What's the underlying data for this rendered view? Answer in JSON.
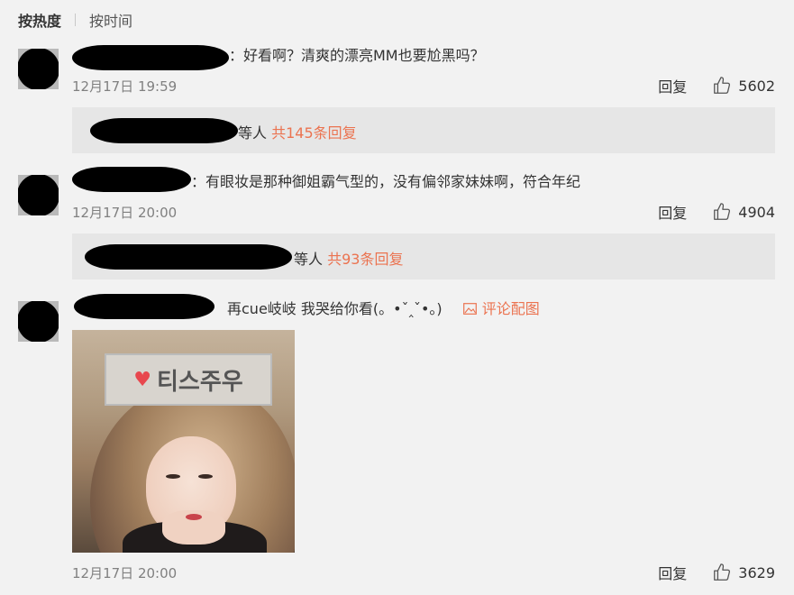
{
  "sort_bar": {
    "active": "按热度",
    "inactive": "按时间"
  },
  "comments": [
    {
      "text": "：好看啊？清爽的漂亮MM也要尬黑吗？",
      "time": "12月17日 19:59",
      "reply_label": "回复",
      "likes": "5602",
      "reply_summary": {
        "suffix": "等人",
        "count_text": "共145条回复"
      }
    },
    {
      "text": "：有眼妆是那种御姐霸气型的，没有偏邻家妹妹啊，符合年纪",
      "time": "12月17日 20:00",
      "reply_label": "回复",
      "likes": "4904",
      "reply_summary": {
        "suffix": "等人",
        "count_text": "共93条回复"
      }
    },
    {
      "text": "再cue岐岐 我哭给你看(。•ˇ‸ˇ•。)",
      "pic_link": "评论配图",
      "photo_text": "티스주우",
      "time": "12月17日 20:00",
      "reply_label": "回复",
      "likes": "3629"
    }
  ],
  "colors": {
    "accent": "#eb7350",
    "background": "#f2f2f2",
    "reply_box": "#e6e6e6",
    "time_text": "#808080"
  },
  "icons": {
    "like": "thumbs-up-icon",
    "picture": "image-icon"
  }
}
